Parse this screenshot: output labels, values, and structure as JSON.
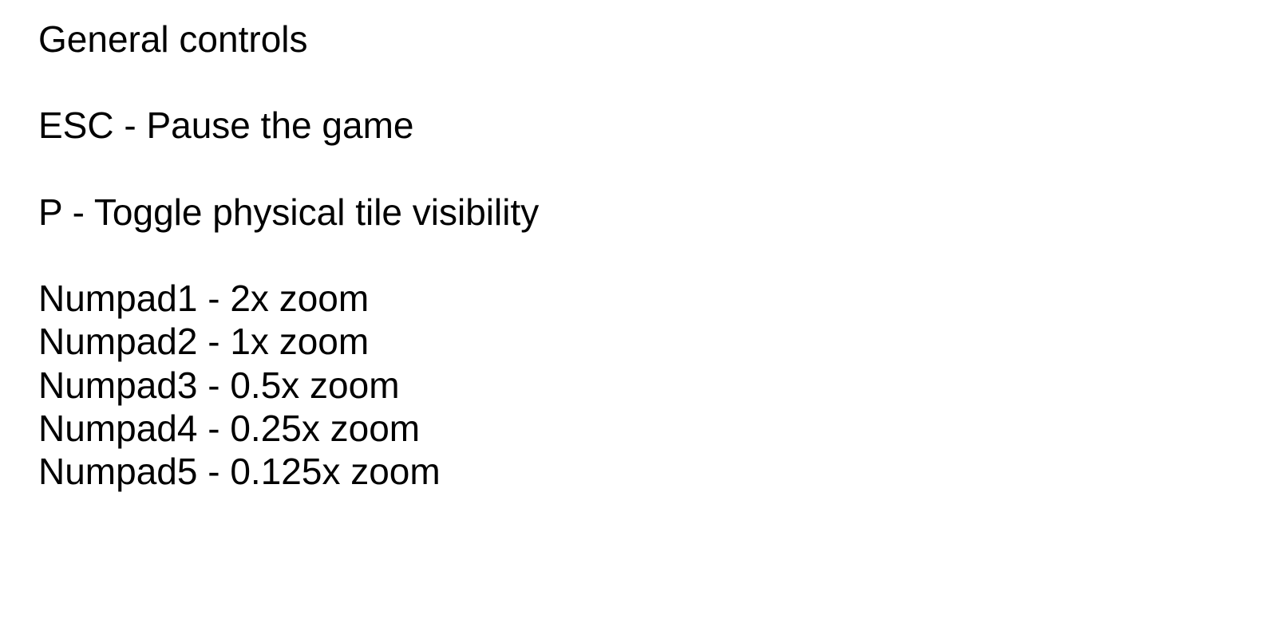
{
  "title": "General controls",
  "controls": {
    "pause": "ESC - Pause the game",
    "tile_visibility": "P - Toggle physical tile visibility"
  },
  "zoom_controls": [
    "Numpad1 - 2x zoom",
    "Numpad2 - 1x zoom",
    "Numpad3 - 0.5x zoom",
    "Numpad4 - 0.25x zoom",
    "Numpad5 - 0.125x zoom"
  ],
  "colors": {
    "background": "#ffffff",
    "text": "#000000"
  }
}
